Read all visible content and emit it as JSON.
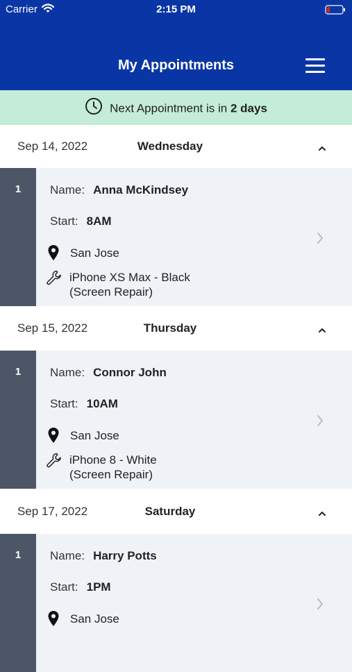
{
  "status_bar": {
    "carrier": "Carrier",
    "time": "2:15 PM"
  },
  "header": {
    "title": "My Appointments"
  },
  "banner": {
    "prefix": "Next Appointment is in ",
    "highlight": "2 days"
  },
  "labels": {
    "name": "Name:",
    "start": "Start:"
  },
  "days": [
    {
      "date": "Sep 14, 2022",
      "weekday": "Wednesday",
      "appointment": {
        "index": "1",
        "name": "Anna McKindsey",
        "start": "8AM",
        "location": "San Jose",
        "device": "iPhone XS Max - Black",
        "service": "(Screen Repair)"
      }
    },
    {
      "date": "Sep 15, 2022",
      "weekday": "Thursday",
      "appointment": {
        "index": "1",
        "name": "Connor John",
        "start": "10AM",
        "location": "San Jose",
        "device": "iPhone 8 - White",
        "service": "(Screen Repair)"
      }
    },
    {
      "date": "Sep 17, 2022",
      "weekday": "Saturday",
      "appointment": {
        "index": "1",
        "name": "Harry Potts",
        "start": "1PM",
        "location": "San Jose"
      }
    }
  ],
  "colors": {
    "header": "#0a36a5",
    "banner": "#c4ecd8",
    "index_bar": "#4c5666",
    "card": "#eff3f7"
  },
  "icons": [
    "wifi-icon",
    "battery-icon",
    "menu-icon",
    "clock-icon",
    "chevron-up-icon",
    "location-pin-icon",
    "wrench-icon",
    "chevron-right-icon"
  ]
}
